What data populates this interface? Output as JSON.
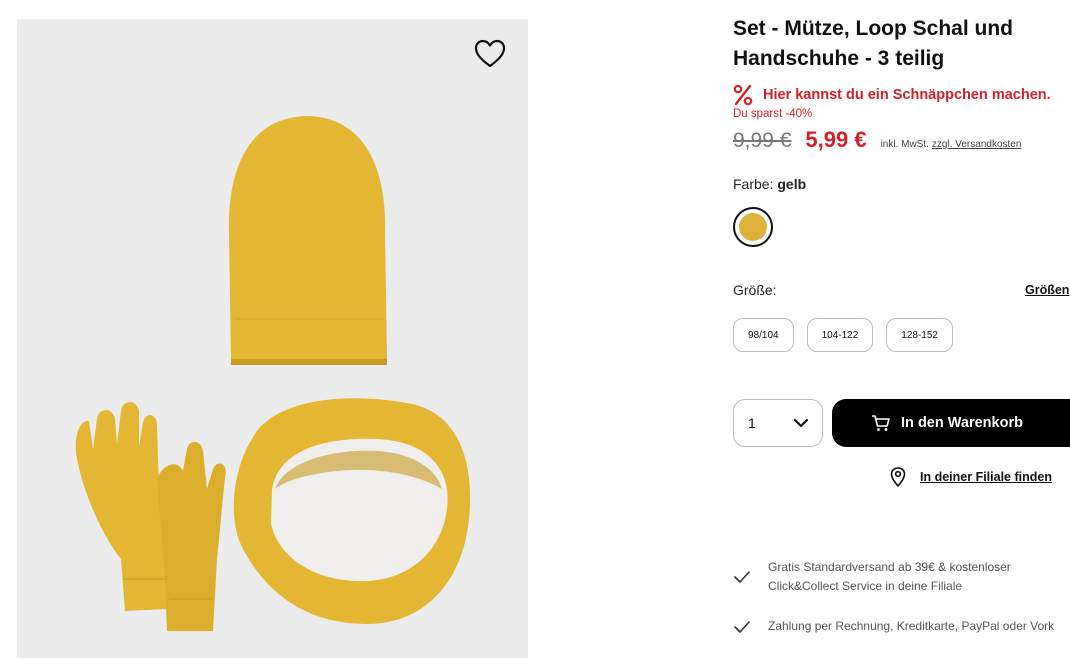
{
  "product": {
    "title": "Set - Mütze, Loop Schal und Handschuhe - 3 teilig",
    "promo_text": "Hier kannst du ein Schnäppchen machen.",
    "savings": "Du sparst -40%",
    "old_price": "9,99 €",
    "new_price": "5,99 €",
    "tax_note": "inkl. MwSt.",
    "shipping_link": "zzgl. Versandkosten"
  },
  "color": {
    "label": "Farbe:",
    "value": "gelb",
    "swatch_hex": "#dcb23a"
  },
  "size": {
    "label": "Größe:",
    "guide_link": "Größen",
    "options": [
      "98/104",
      "104-122",
      "128-152"
    ]
  },
  "purchase": {
    "quantity": "1",
    "cart_label": "In den Warenkorb",
    "store_link": "In deiner Filiale finden"
  },
  "info": {
    "shipping_line1": "Gratis Standardversand ab 39€ & kostenloser",
    "shipping_line2": "Click&Collect Service in deine Filiale",
    "payment": "Zahlung per Rechnung, Kreditkarte, PayPal oder Vork"
  },
  "colors": {
    "sale_red": "#d0202a",
    "product_yellow": "#e2b431",
    "gallery_bg": "#ececec"
  }
}
